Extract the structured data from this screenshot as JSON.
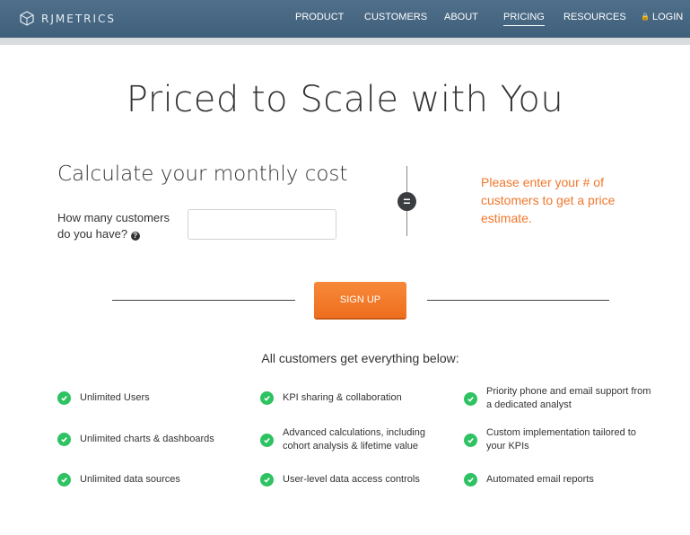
{
  "header": {
    "logo_text": "RJMETRICS",
    "nav": [
      {
        "label": "PRODUCT"
      },
      {
        "label": "CUSTOMERS"
      },
      {
        "label": "ABOUT"
      },
      {
        "label": "PRICING",
        "active": true
      },
      {
        "label": "RESOURCES"
      },
      {
        "label": "LOGIN",
        "icon": "lock-icon"
      }
    ]
  },
  "main": {
    "title": "Priced to Scale with You",
    "calculator": {
      "title": "Calculate your monthly cost",
      "question_line1": "How many customers",
      "question_line2": "do you have?",
      "input_value": "",
      "equals_symbol": "=",
      "estimate_message": "Please enter your # of customers to get a price estimate."
    },
    "signup_label": "SIGN UP",
    "features_heading": "All customers get everything below:",
    "features": [
      "Unlimited Users",
      "KPI sharing & collaboration",
      "Priority phone and email support from a dedicated analyst",
      "Unlimited charts & dashboards",
      "Advanced calculations, including cohort analysis & lifetime value",
      "Custom implementation tailored to your KPIs",
      "Unlimited data sources",
      "User-level data access controls",
      "Automated email reports"
    ]
  },
  "colors": {
    "header_bg": "#466782",
    "accent_orange": "#f0772c",
    "check_green": "#2ec262"
  }
}
